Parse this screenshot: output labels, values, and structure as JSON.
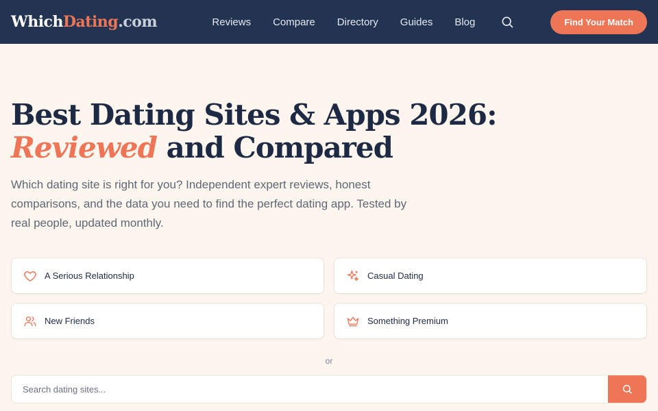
{
  "header": {
    "logo": {
      "part1": "Which",
      "part2": "Dating",
      "part3": ".com"
    },
    "nav": [
      {
        "label": "Reviews"
      },
      {
        "label": "Compare"
      },
      {
        "label": "Directory"
      },
      {
        "label": "Guides"
      },
      {
        "label": "Blog"
      }
    ],
    "search_icon": "search-icon",
    "cta_label": "Find Your Match"
  },
  "hero": {
    "headline_main": "Best Dating Sites & Apps 2026: ",
    "headline_accent": "Reviewed",
    "headline_rest": " and Compared",
    "subtext": "Which dating site is right for you? Independent expert reviews, honest comparisons, and the data you need to find the perfect dating app. Tested by real people, updated monthly."
  },
  "options": [
    {
      "label": "A Serious Relationship",
      "icon": "heart-icon"
    },
    {
      "label": "Casual Dating",
      "icon": "sparkle-icon"
    },
    {
      "label": "New Friends",
      "icon": "users-icon"
    },
    {
      "label": "Something Premium",
      "icon": "crown-icon"
    }
  ],
  "divider_text": "or",
  "search": {
    "placeholder": "Search dating sites..."
  },
  "colors": {
    "nav_bg": "#223452",
    "accent": "#ee7657",
    "page_bg": "#fdf6ef",
    "heading": "#1e2a44"
  }
}
